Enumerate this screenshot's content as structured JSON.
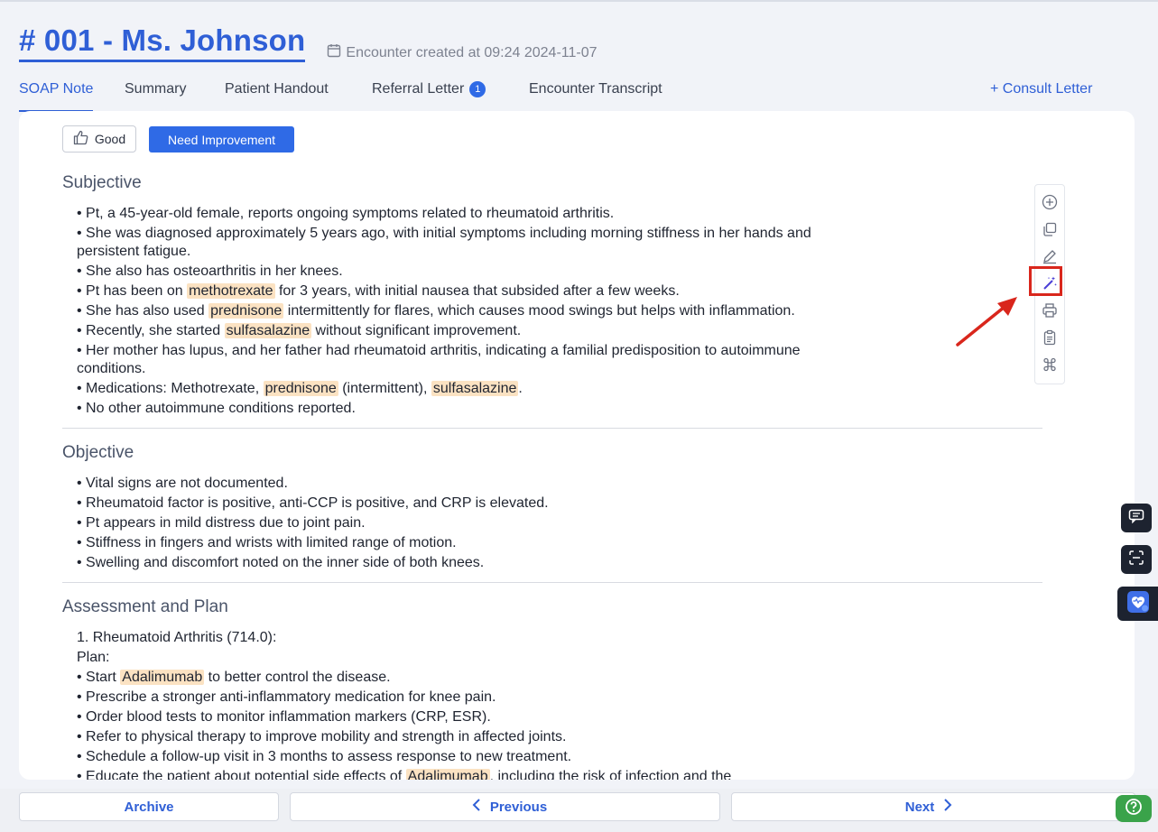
{
  "header": {
    "title": "# 001 - Ms. Johnson",
    "encounter_meta": "Encounter created at 09:24 2024-11-07"
  },
  "tabs": [
    {
      "label": "SOAP Note",
      "active": true
    },
    {
      "label": "Summary"
    },
    {
      "label": "Patient Handout"
    },
    {
      "label": "Referral Letter",
      "badge": "1"
    },
    {
      "label": "Encounter Transcript"
    }
  ],
  "consult_link": "+ Consult Letter",
  "feedback": {
    "good": "Good",
    "need": "Need Improvement"
  },
  "sections": [
    {
      "title": "Subjective",
      "items": [
        [
          "• Pt, a 45-year-old female, reports ongoing symptoms related to rheumatoid arthritis."
        ],
        [
          "• She was diagnosed approximately 5 years ago, with initial symptoms including morning stiffness in her hands and persistent fatigue."
        ],
        [
          "• She also has osteoarthritis in her knees."
        ],
        [
          "• Pt has been on ",
          {
            "hl": "methotrexate"
          },
          " for 3 years, with initial nausea that subsided after a few weeks."
        ],
        [
          "• She has also used ",
          {
            "hl": "prednisone"
          },
          " intermittently for flares, which causes mood swings but helps with inflammation."
        ],
        [
          "• Recently, she started ",
          {
            "hl": "sulfasalazine"
          },
          " without significant improvement."
        ],
        [
          "• Her mother has lupus, and her father had rheumatoid arthritis, indicating a familial predisposition to autoimmune conditions."
        ],
        [
          "• Medications: Methotrexate, ",
          {
            "hl": "prednisone"
          },
          " (intermittent), ",
          {
            "hl": "sulfasalazine"
          },
          "."
        ],
        [
          "• No other autoimmune conditions reported."
        ]
      ]
    },
    {
      "title": "Objective",
      "items": [
        [
          "• Vital signs are not documented."
        ],
        [
          "• Rheumatoid factor is positive, anti-CCP is positive, and CRP is elevated."
        ],
        [
          "• Pt appears in mild distress due to joint pain."
        ],
        [
          "• Stiffness in fingers and wrists with limited range of motion."
        ],
        [
          "• Swelling and discomfort noted on the inner side of both knees."
        ]
      ]
    },
    {
      "title": "Assessment and Plan",
      "items": [
        [
          "1. Rheumatoid Arthritis (714.0):"
        ],
        [
          "Plan:"
        ],
        [
          "• Start ",
          {
            "hl": "Adalimumab"
          },
          " to better control the disease."
        ],
        [
          "• Prescribe a stronger anti-inflammatory medication for knee pain."
        ],
        [
          "• Order blood tests to monitor inflammation markers (CRP, ESR)."
        ],
        [
          "• Refer to physical therapy to improve mobility and strength in affected joints."
        ],
        [
          "• Schedule a follow-up visit in 3 months to assess response to new treatment."
        ],
        [
          "• Educate the patient about potential side effects of ",
          {
            "hl": "Adalimumab"
          },
          ", including the risk of infection and the"
        ]
      ]
    }
  ],
  "toolbar_icons": [
    "add-circle-icon",
    "copy-icon",
    "edit-icon",
    "magic-wand-icon",
    "print-icon",
    "clipboard-icon",
    "command-icon"
  ],
  "bottom": {
    "archive": "Archive",
    "previous": "Previous",
    "next": "Next"
  },
  "colors": {
    "accent": "#2f5fd6",
    "highlight": "#fbe2c2",
    "callout": "#d9261c",
    "help": "#3aa34a"
  }
}
